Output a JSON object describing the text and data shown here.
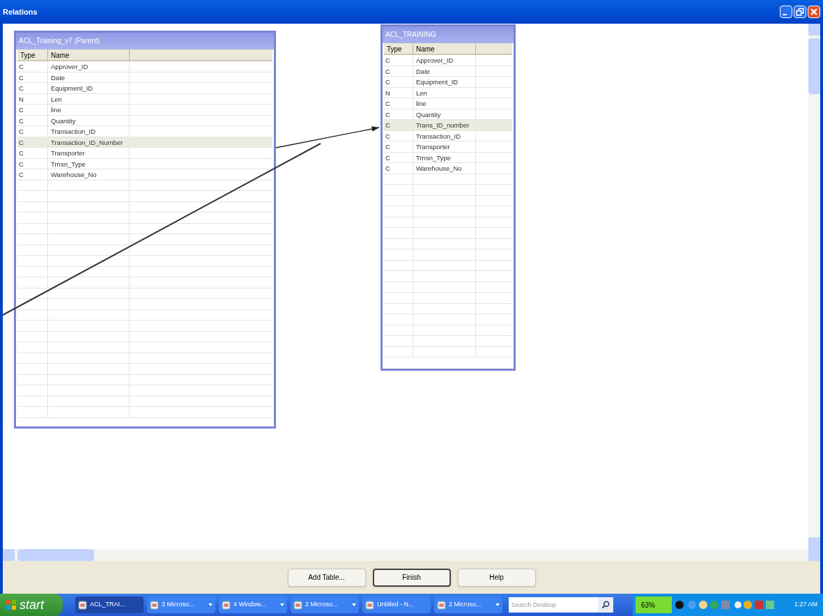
{
  "window": {
    "title": "Relations"
  },
  "tables": [
    {
      "title": "ACL_Training_v7 (Parent)",
      "columns": [
        "Type",
        "Name"
      ],
      "rows": [
        {
          "type": "C",
          "name": "Approver_ID",
          "selected": false
        },
        {
          "type": "C",
          "name": "Date",
          "selected": false
        },
        {
          "type": "C",
          "name": "Equipment_ID",
          "selected": false
        },
        {
          "type": "N",
          "name": "Len",
          "selected": false
        },
        {
          "type": "C",
          "name": "line",
          "selected": false
        },
        {
          "type": "C",
          "name": "Quantity",
          "selected": false
        },
        {
          "type": "C",
          "name": "Transaction_ID",
          "selected": false
        },
        {
          "type": "C",
          "name": "Transaction_ID_Number",
          "selected": true
        },
        {
          "type": "C",
          "name": "Transporter",
          "selected": false
        },
        {
          "type": "C",
          "name": "Trnsn_Type",
          "selected": false
        },
        {
          "type": "C",
          "name": "Warehouse_No",
          "selected": false
        }
      ]
    },
    {
      "title": "ACL_TRAINING",
      "columns": [
        "Type",
        "Name"
      ],
      "rows": [
        {
          "type": "C",
          "name": "Approver_ID",
          "selected": false
        },
        {
          "type": "C",
          "name": "Date",
          "selected": false
        },
        {
          "type": "C",
          "name": "Equipment_ID",
          "selected": false
        },
        {
          "type": "N",
          "name": "Len",
          "selected": false
        },
        {
          "type": "C",
          "name": "line",
          "selected": false
        },
        {
          "type": "C",
          "name": "Quantity",
          "selected": false
        },
        {
          "type": "C",
          "name": "Trans_ID_number",
          "selected": true
        },
        {
          "type": "C",
          "name": "Transaction_ID",
          "selected": false
        },
        {
          "type": "C",
          "name": "Transporter",
          "selected": false
        },
        {
          "type": "C",
          "name": "Trnsn_Type",
          "selected": false
        },
        {
          "type": "C",
          "name": "Warehouse_No",
          "selected": false
        }
      ]
    }
  ],
  "buttons": [
    {
      "label": "Add Table...",
      "focused": false
    },
    {
      "label": "Finish",
      "focused": true
    },
    {
      "label": "Help",
      "focused": false
    }
  ],
  "taskbar": {
    "start": "start",
    "items": [
      {
        "label": "ACL_TRAI...",
        "active": true,
        "group": false
      },
      {
        "label": "3 Microso...",
        "active": false,
        "group": true
      },
      {
        "label": "4 Window...",
        "active": false,
        "group": true
      },
      {
        "label": "2 Microso...",
        "active": false,
        "group": true
      },
      {
        "label": "Untitled - N...",
        "active": false,
        "group": false
      },
      {
        "label": "2 Microso...",
        "active": false,
        "group": true
      }
    ],
    "search_placeholder": "Search Desktop",
    "battery": "63%",
    "clock": "1:27 AM"
  }
}
